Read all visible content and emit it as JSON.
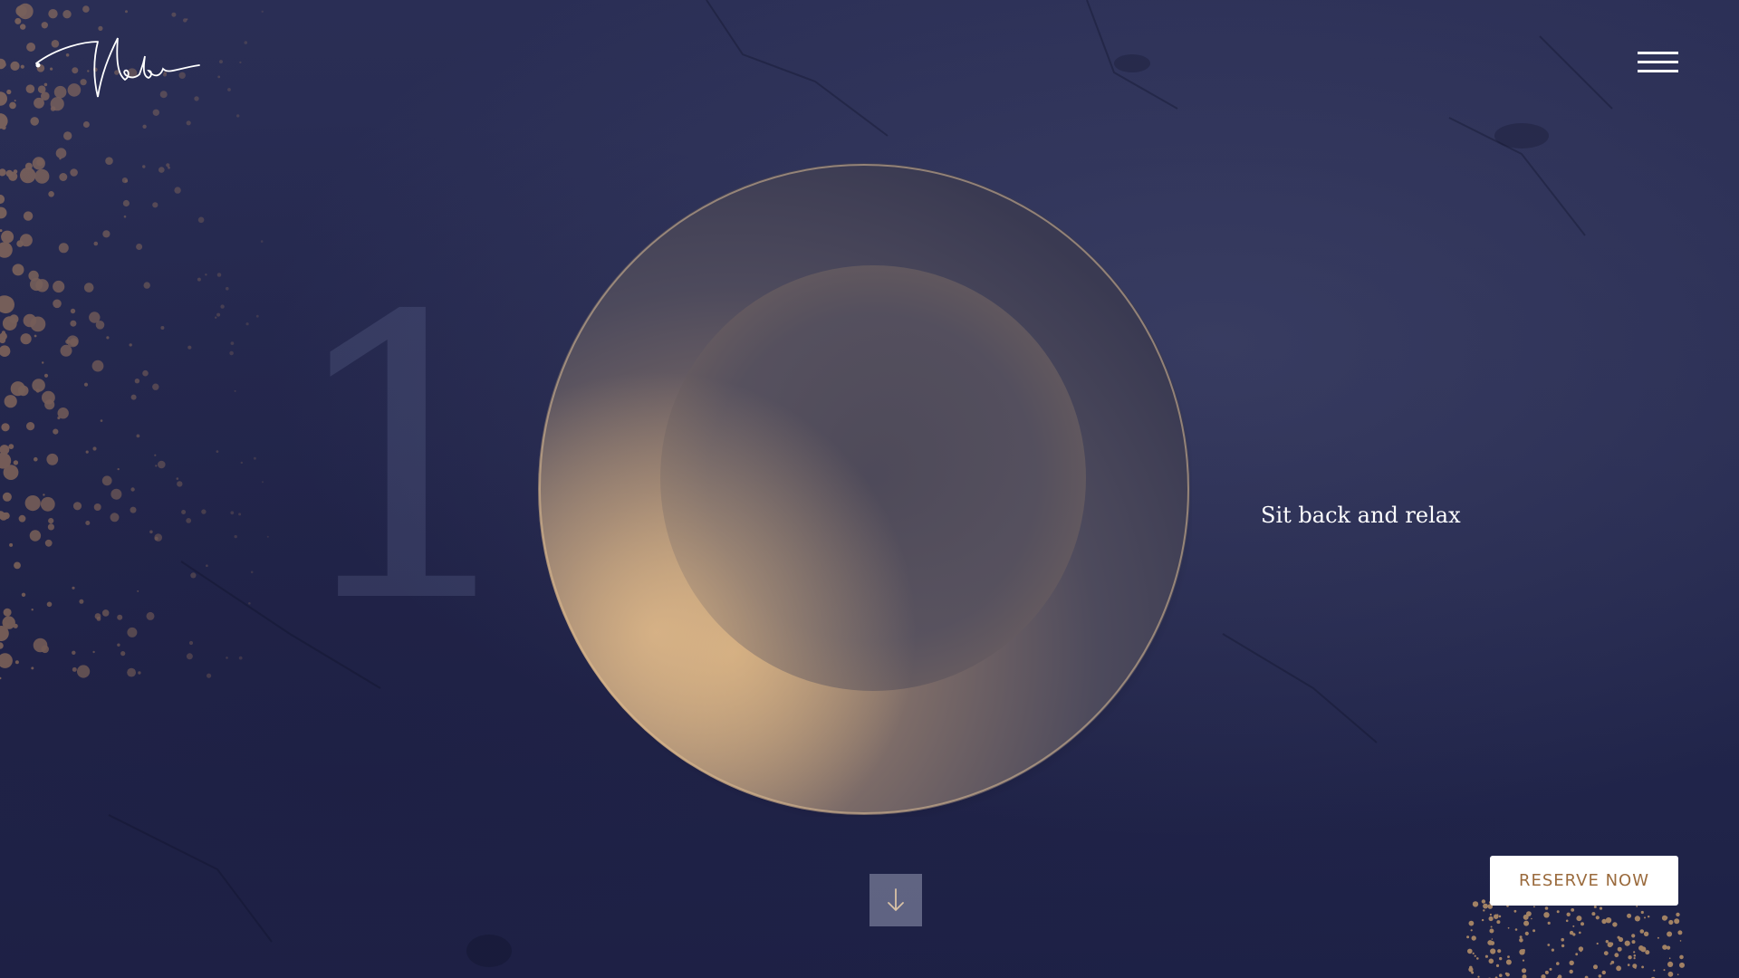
{
  "header": {
    "logo_text": "Nebo",
    "menu_icon": "hamburger-menu-icon"
  },
  "hero": {
    "step_number": "1",
    "tagline": "Sit back and relax",
    "image_subject": "empty-plate"
  },
  "scroll": {
    "icon": "arrow-down-icon"
  },
  "cta": {
    "reserve_label": "RESERVE NOW"
  },
  "colors": {
    "background": "#262a50",
    "accent_gold": "#c49a6c",
    "button_text": "#9a6a3c",
    "white": "#ffffff"
  }
}
